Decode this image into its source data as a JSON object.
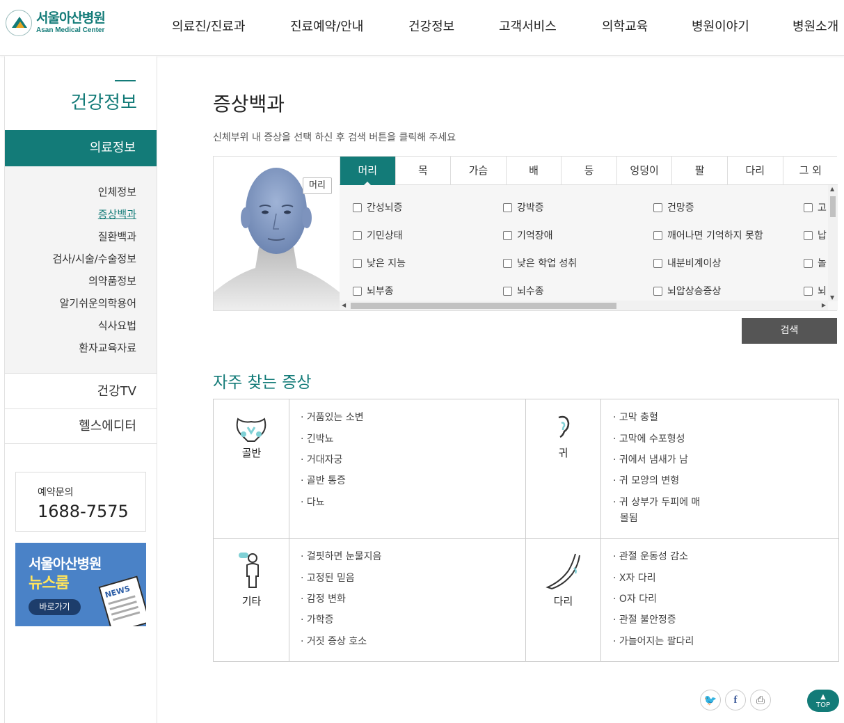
{
  "header": {
    "logo_ko": "서울아산병원",
    "logo_en": "Asan Medical Center",
    "menu": [
      "의료진/진료과",
      "진료예약/안내",
      "건강정보",
      "고객서비스",
      "의학교육",
      "병원이야기",
      "병원소개"
    ]
  },
  "sidebar": {
    "title": "건강정보",
    "active": "의료정보",
    "sub_items": [
      "인체정보",
      "증상백과",
      "질환백과",
      "검사/시술/수술정보",
      "의약품정보",
      "알기쉬운의학용어",
      "식사요법",
      "환자교육자료"
    ],
    "rows": [
      "건강TV",
      "헬스에디터"
    ],
    "reserve_label": "예약문의",
    "reserve_number": "1688-7575",
    "banner_line1": "서울아산병원",
    "banner_line2": "뉴스룸",
    "banner_button": "바로가기",
    "banner_news": "NEWS"
  },
  "main": {
    "title": "증상백과",
    "guide": "신체부위 내 증상을 선택 하신 후 검색 버튼을 클릭해 주세요",
    "face_tag": "머리",
    "tabs": [
      "머리",
      "목",
      "가슴",
      "배",
      "등",
      "엉덩이",
      "팔",
      "다리",
      "그 외"
    ],
    "symptoms": [
      [
        "간성뇌증",
        "강박증",
        "건망증",
        "고"
      ],
      [
        "기민상태",
        "기억장애",
        "깨어나면 기억하지 못함",
        "납"
      ],
      [
        "낮은 지능",
        "낮은 학업 성취",
        "내분비계이상",
        "놀"
      ],
      [
        "뇌부종",
        "뇌수종",
        "뇌압상승증상",
        "뇌"
      ]
    ],
    "search_button": "검색",
    "freq_title": "자주 찾는 증상",
    "freq": [
      {
        "label": "골반",
        "icon": "pelvis-icon",
        "items": [
          "거품있는 소변",
          "긴박뇨",
          "거대자궁",
          "골반 통증",
          "다뇨"
        ]
      },
      {
        "label": "귀",
        "icon": "ear-icon",
        "items": [
          "고막 충혈",
          "고막에 수포형성",
          "귀에서 냄새가 남",
          "귀 모양의 변형",
          "귀 상부가 두피에 매",
          "몰됨"
        ]
      },
      {
        "label": "기타",
        "icon": "person-icon",
        "items": [
          "걸핏하면 눈물지음",
          "고정된 믿음",
          "감정 변화",
          "가학증",
          "거짓 증상 호소"
        ]
      },
      {
        "label": "다리",
        "icon": "leg-icon",
        "items": [
          "관절 운동성 감소",
          "X자 다리",
          "O자 다리",
          "관절 불안정증",
          "가늘어지는 팔다리"
        ]
      }
    ]
  },
  "footer": {
    "top_label": "TOP",
    "social": [
      "twitter-icon",
      "facebook-icon",
      "print-icon"
    ]
  },
  "colors": {
    "accent": "#137b78",
    "button_gray": "#555555",
    "banner_blue": "#4a82c7"
  }
}
